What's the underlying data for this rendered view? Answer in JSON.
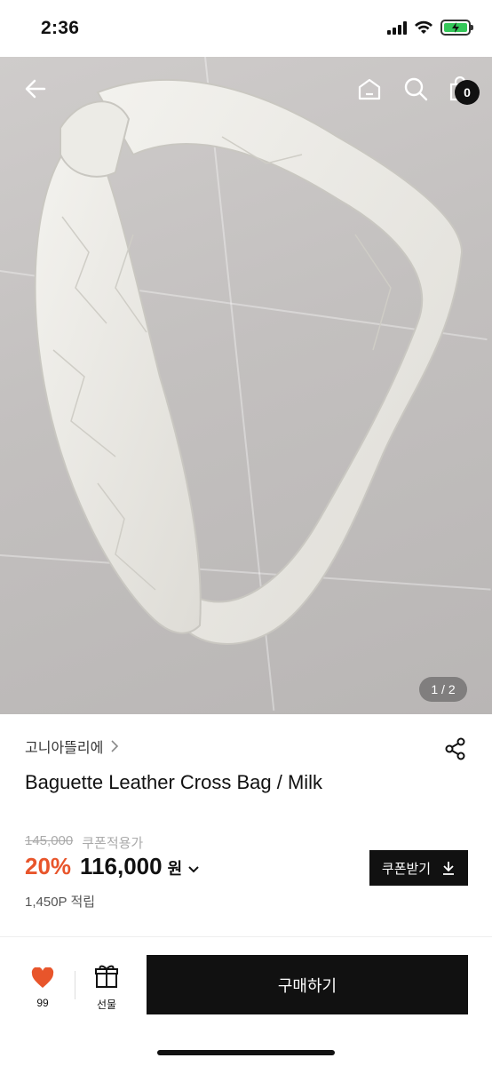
{
  "status_bar": {
    "time": "2:36"
  },
  "nav": {
    "cart_count": "0"
  },
  "gallery": {
    "pager": "1 / 2"
  },
  "product": {
    "brand": "고니아뜰리에",
    "title": "Baguette Leather Cross Bag / Milk",
    "original_price": "145,000",
    "coupon_note": "쿠폰적용가",
    "discount": "20%",
    "price": "116,000",
    "currency": "원",
    "points": "1,450P 적립",
    "coupon_button": "쿠폰받기"
  },
  "bottom_bar": {
    "like_count": "99",
    "gift_label": "선물",
    "buy_label": "구매하기"
  },
  "colors": {
    "accent": "#e8552b",
    "primary": "#111111",
    "battery": "#34c759"
  }
}
